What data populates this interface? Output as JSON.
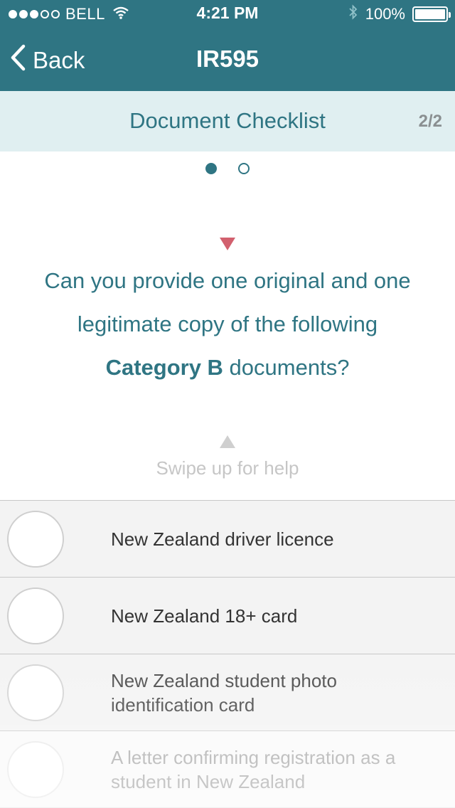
{
  "status_bar": {
    "signal_dots": [
      true,
      true,
      true,
      false,
      false
    ],
    "carrier": "BELL",
    "time": "4:21 PM",
    "battery": "100%"
  },
  "nav": {
    "back_label": "Back",
    "title": "IR595"
  },
  "subheader": {
    "title": "Document Checklist",
    "page_count": "2/2"
  },
  "pager": {
    "total": 2,
    "active": 0
  },
  "question": {
    "before": "Can you provide one original and one legitimate copy of the following ",
    "emphasis": "Category B",
    "after": " documents?"
  },
  "help": {
    "text": "Swipe up for help"
  },
  "checklist": {
    "items": [
      {
        "label": "New Zealand driver licence",
        "checked": false
      },
      {
        "label": "New Zealand 18+ card",
        "checked": false
      },
      {
        "label": "New Zealand student photo identification card",
        "checked": false
      },
      {
        "label": "A letter confirming registration as a student in New Zealand",
        "checked": false
      }
    ]
  },
  "colors": {
    "primary": "#2f7583",
    "subheader_bg": "#e0eff1",
    "arrow_accent": "#d2606e",
    "list_bg": "#f3f3f3"
  }
}
